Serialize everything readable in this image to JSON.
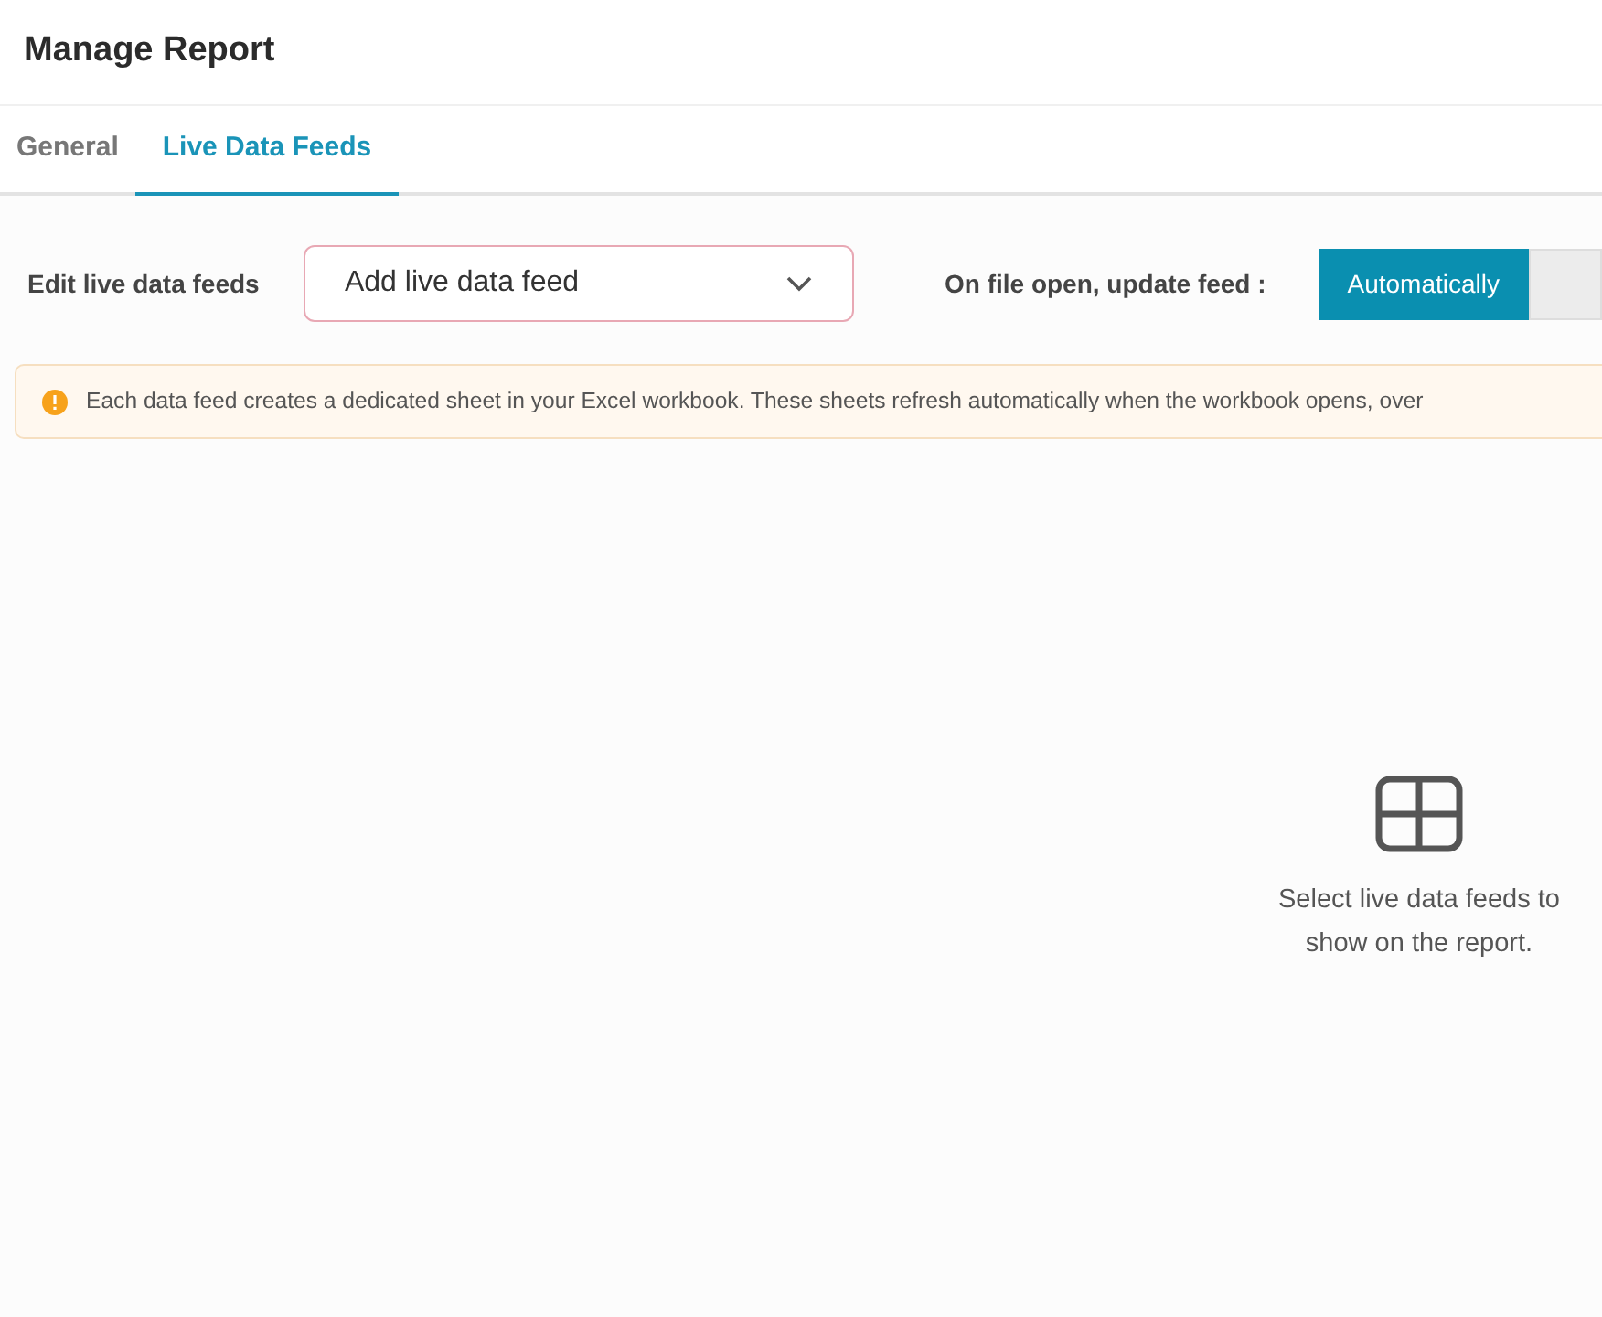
{
  "header": {
    "title": "Manage Report"
  },
  "tabs": [
    {
      "label": "General",
      "selected": false
    },
    {
      "label": "Live Data Feeds",
      "selected": true
    }
  ],
  "feeds": {
    "label": "Edit live data feeds",
    "dropdown": {
      "value": "Add live data feed"
    }
  },
  "update": {
    "label": "On file open, update feed :",
    "options": [
      {
        "label": "Automatically",
        "selected": true
      },
      {
        "selected": false
      }
    ]
  },
  "notice": {
    "text": "Each data feed creates a dedicated sheet in your Excel workbook. These sheets refresh automatically when the workbook opens, over"
  },
  "empty_state": {
    "text": "Select live data feeds to show on the report."
  }
}
